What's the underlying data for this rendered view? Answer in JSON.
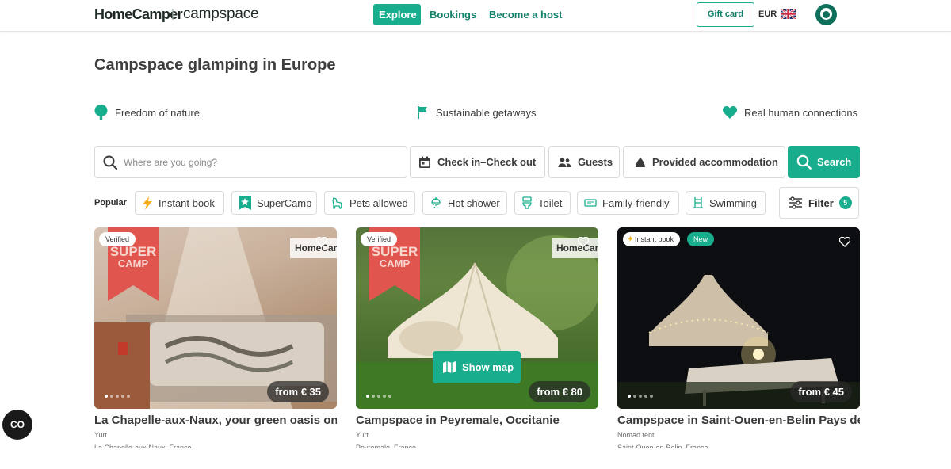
{
  "header": {
    "logo_primary": "HomeCamper",
    "logo_separator": "|",
    "logo_secondary": "campspace",
    "nav": [
      "Explore",
      "Bookings",
      "Become a host"
    ],
    "gift_card": "Gift card",
    "currency": "EUR"
  },
  "page": {
    "title": "Campspace glamping in Europe",
    "features": [
      "Freedom of nature",
      "Sustainable getaways",
      "Real human connections"
    ]
  },
  "search": {
    "placeholder": "Where are you going?",
    "dates": "Check in–Check out",
    "guests": "Guests",
    "accommodation": "Provided accommodation",
    "button": "Search"
  },
  "filters": {
    "popular_label": "Popular",
    "chips": [
      "Instant book",
      "SuperCamp",
      "Pets allowed",
      "Hot shower",
      "Toilet",
      "Family-friendly",
      "Swimming"
    ],
    "filter_label": "Filter",
    "filter_count": "5"
  },
  "listings": [
    {
      "badges": [
        "Verified"
      ],
      "supercamp": [
        "SUPER",
        "CAMP"
      ],
      "watermark": "HomeCamper",
      "price": "from € 35",
      "title": "La Chapelle-aux-Naux, your green oasis on the",
      "type": "Yurt",
      "location": "La Chapelle-aux-Naux, France"
    },
    {
      "badges": [
        "Verified"
      ],
      "supercamp": [
        "SUPER",
        "CAMP"
      ],
      "watermark": "HomeCamper",
      "show_map": "Show map",
      "price": "from € 80",
      "title": "Campspace in Peyremale, Occitanie",
      "type": "Yurt",
      "location": "Peyremale, France"
    },
    {
      "badges": [
        "Instant book",
        "New"
      ],
      "price": "from € 45",
      "title": "Campspace in Saint-Ouen-en-Belin Pays de",
      "type": "Nomad tent",
      "location": "Saint-Ouen-en-Belin, France"
    }
  ],
  "widget": {
    "label": "CO"
  },
  "colors": {
    "accent": "#18ad8c",
    "accent_dark": "#11826b",
    "supercamp_ribbon": "#e0564f"
  }
}
